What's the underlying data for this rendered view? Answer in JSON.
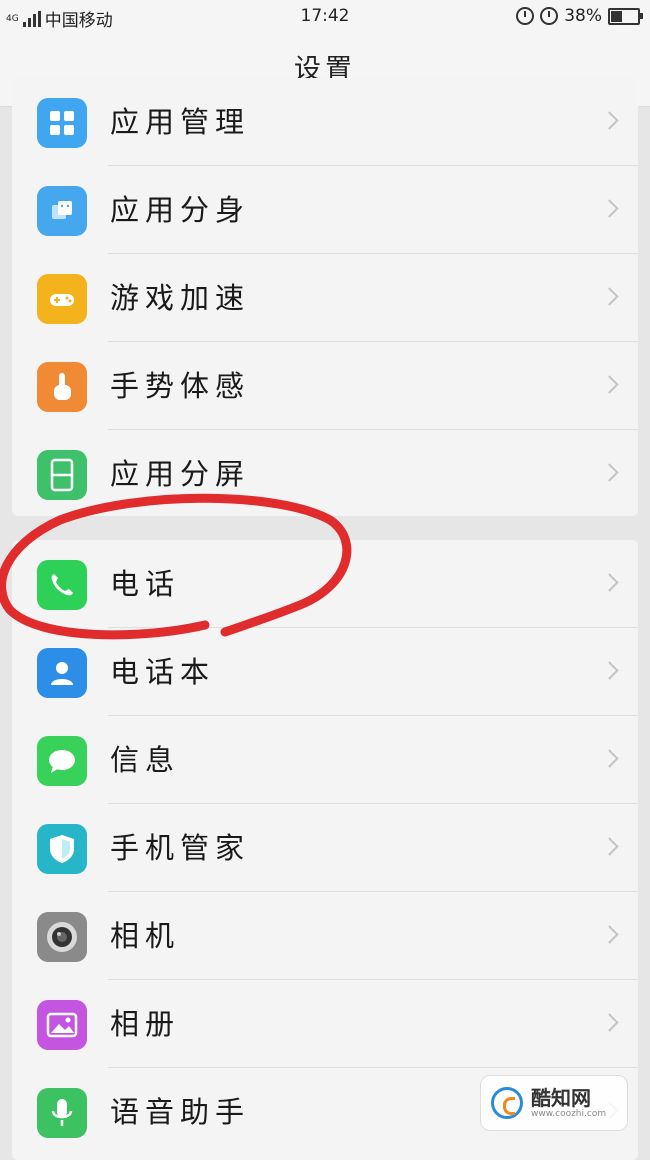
{
  "status_bar": {
    "network": "4G",
    "carrier": "中国移动",
    "time": "17:42",
    "battery_percent": "38%",
    "battery_level": 0.38
  },
  "header": {
    "title": "设置"
  },
  "groups": [
    {
      "items": [
        {
          "label": "应用管理",
          "icon": "grid-icon",
          "icon_color": "#41a6f0"
        },
        {
          "label": "应用分身",
          "icon": "android-icon",
          "icon_color": "#45a8ef"
        },
        {
          "label": "游戏加速",
          "icon": "gamepad-rocket-icon",
          "icon_color": "#f4b21d"
        },
        {
          "label": "手势体感",
          "icon": "hand-gesture-icon",
          "icon_color": "#f08a35"
        },
        {
          "label": "应用分屏",
          "icon": "split-screen-icon",
          "icon_color": "#3fc16b"
        }
      ]
    },
    {
      "items": [
        {
          "label": "电话",
          "icon": "phone-icon",
          "icon_color": "#2ed158"
        },
        {
          "label": "电话本",
          "icon": "contacts-icon",
          "icon_color": "#2d8ee8"
        },
        {
          "label": "信息",
          "icon": "message-icon",
          "icon_color": "#38d25a"
        },
        {
          "label": "手机管家",
          "icon": "shield-icon",
          "icon_color": "#27b6c9"
        },
        {
          "label": "相机",
          "icon": "camera-icon",
          "icon_color": "#8a8a8a"
        },
        {
          "label": "相册",
          "icon": "gallery-icon",
          "icon_color": "#c455e0"
        },
        {
          "label": "语音助手",
          "icon": "microphone-icon",
          "icon_color": "#3cc260"
        }
      ]
    }
  ],
  "watermark": {
    "name": "酷知网",
    "url": "www.coozhi.com"
  }
}
